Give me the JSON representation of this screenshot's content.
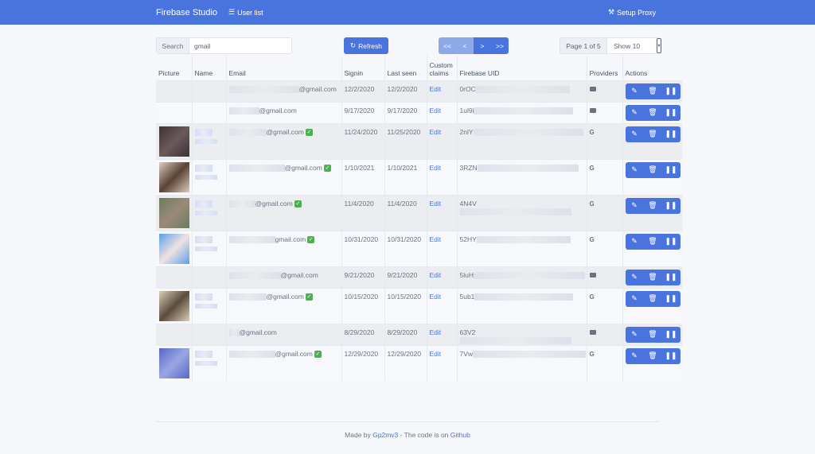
{
  "header": {
    "brand": "Firebase Studio",
    "nav_userlist": "User list",
    "nav_proxy": "Setup Proxy",
    "accent": "#4a74dd"
  },
  "toolbar": {
    "search_label": "Search",
    "search_value": "gmail",
    "refresh_label": "Refresh",
    "pager": [
      "<<",
      "<",
      ">",
      ">>"
    ],
    "page_info": "Page 1 of 5",
    "show_label": "Show 10"
  },
  "table": {
    "columns": [
      "Picture",
      "Name",
      "Email",
      "Signin",
      "Last seen",
      "Custom claims",
      "Firebase UID",
      "Providers",
      "Actions"
    ],
    "edit_label": "Edit",
    "rows": [
      {
        "email": "@gmail.com",
        "signin": "12/2/2020",
        "last_seen": "12/2/2020",
        "uid": "0rOC",
        "provider": "email",
        "verified": false
      },
      {
        "email": "@gmail.com",
        "signin": "9/17/2020",
        "last_seen": "9/17/2020",
        "uid": "1ul9i",
        "provider": "email",
        "verified": false
      },
      {
        "email": "@gmail.com",
        "signin": "11/24/2020",
        "last_seen": "11/25/2020",
        "uid": "2nlY",
        "provider": "google",
        "verified": true
      },
      {
        "email": "@gmail.com",
        "signin": "1/10/2021",
        "last_seen": "1/10/2021",
        "uid": "3RZN",
        "provider": "google",
        "verified": true
      },
      {
        "email": "@gmail.com",
        "signin": "11/4/2020",
        "last_seen": "11/4/2020",
        "uid": "4N4V",
        "provider": "google",
        "verified": true
      },
      {
        "email": "gmail.com",
        "signin": "10/31/2020",
        "last_seen": "10/31/2020",
        "uid": "52HY",
        "provider": "google",
        "verified": true
      },
      {
        "email": "@gmail.com",
        "signin": "9/21/2020",
        "last_seen": "9/21/2020",
        "uid": "5luH",
        "provider": "email",
        "verified": false
      },
      {
        "email": "@gmail.com",
        "signin": "10/15/2020",
        "last_seen": "10/15/2020",
        "uid": "5ub1",
        "provider": "google",
        "verified": true
      },
      {
        "email": "@gmail.com",
        "signin": "8/29/2020",
        "last_seen": "8/29/2020",
        "uid": "63V2",
        "provider": "email",
        "verified": false
      },
      {
        "email": "@gmail.com",
        "signin": "12/29/2020",
        "last_seen": "12/29/2020",
        "uid": "7Vw",
        "provider": "google",
        "verified": true
      }
    ]
  },
  "footer": {
    "made_by": "Made by ",
    "author": "Gp2mv3",
    "middle": " - The code is on ",
    "repo": "Github"
  }
}
